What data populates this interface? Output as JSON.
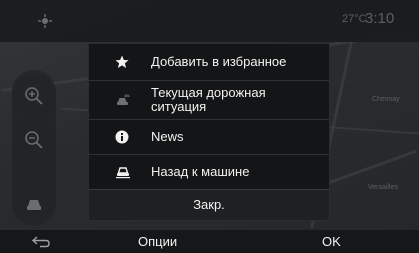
{
  "status_bar": {
    "temperature": "27°C",
    "time": "3:10"
  },
  "map": {
    "labels": [
      "Chesnay",
      "Versailles"
    ]
  },
  "popup_menu": {
    "items": [
      {
        "icon": "star-icon",
        "label": "Добавить в избранное"
      },
      {
        "icon": "traffic-car-icon",
        "label_line1": "Текущая дорожная",
        "label_line2": "ситуация"
      },
      {
        "icon": "info-icon",
        "label": "News"
      },
      {
        "icon": "car-icon",
        "label": "Назад к машине"
      }
    ],
    "close_label": "Закр."
  },
  "bottom_bar": {
    "options_label": "Опции",
    "ok_label": "OK"
  }
}
